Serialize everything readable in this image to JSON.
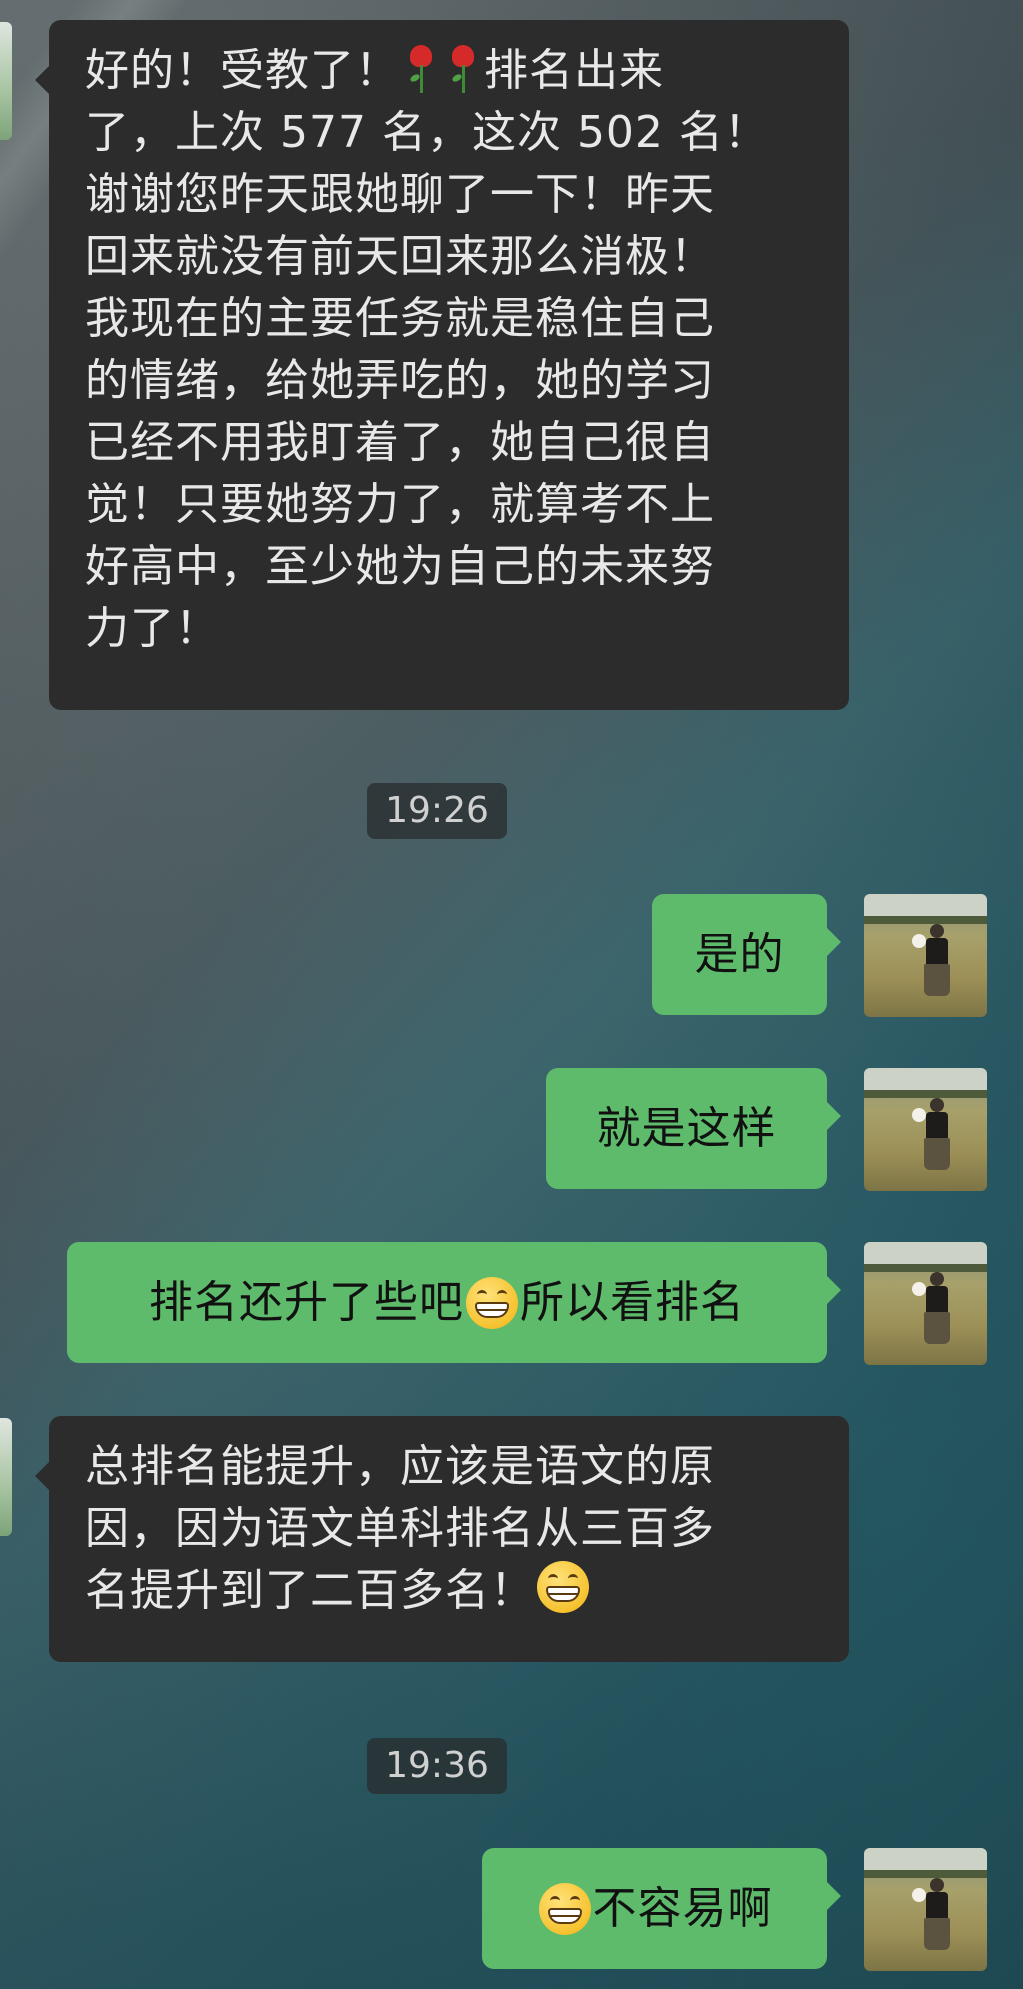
{
  "messages": [
    {
      "side": "in",
      "lines": [
        [
          "好的！受教了！",
          "rose-emoji",
          "rose-emoji",
          "排名出来"
        ],
        [
          "了，上次 577 名，这次 502 名！"
        ],
        [
          "谢谢您昨天跟她聊了一下！昨天"
        ],
        [
          "回来就没有前天回来那么消极！"
        ],
        [
          "我现在的主要任务就是稳住自己"
        ],
        [
          "的情绪，给她弄吃的，她的学习"
        ],
        [
          "已经不用我盯着了，她自己很自"
        ],
        [
          "觉！只要她努力了，就算考不上"
        ],
        [
          "好高中，至少她为自己的未来努"
        ],
        [
          "力了！"
        ]
      ]
    },
    {
      "side": "time",
      "text": "19:26"
    },
    {
      "side": "out",
      "parts": [
        "是的"
      ]
    },
    {
      "side": "out",
      "parts": [
        "就是这样"
      ]
    },
    {
      "side": "out",
      "parts": [
        "排名还升了些吧",
        "grin-emoji",
        "所以看排名"
      ]
    },
    {
      "side": "in",
      "lines": [
        [
          "总排名能提升，应该是语文的原"
        ],
        [
          "因，因为语文单科排名从三百多"
        ],
        [
          "名提升到了二百多名！",
          "grin-emoji"
        ]
      ]
    },
    {
      "side": "time",
      "text": "19:36"
    },
    {
      "side": "out",
      "parts": [
        "grin-emoji",
        "不容易啊"
      ]
    }
  ],
  "colors": {
    "incoming_bubble": "#2c2c2c",
    "outgoing_bubble": "#5ebb6c",
    "timestamp_bg": "#282c2e"
  }
}
